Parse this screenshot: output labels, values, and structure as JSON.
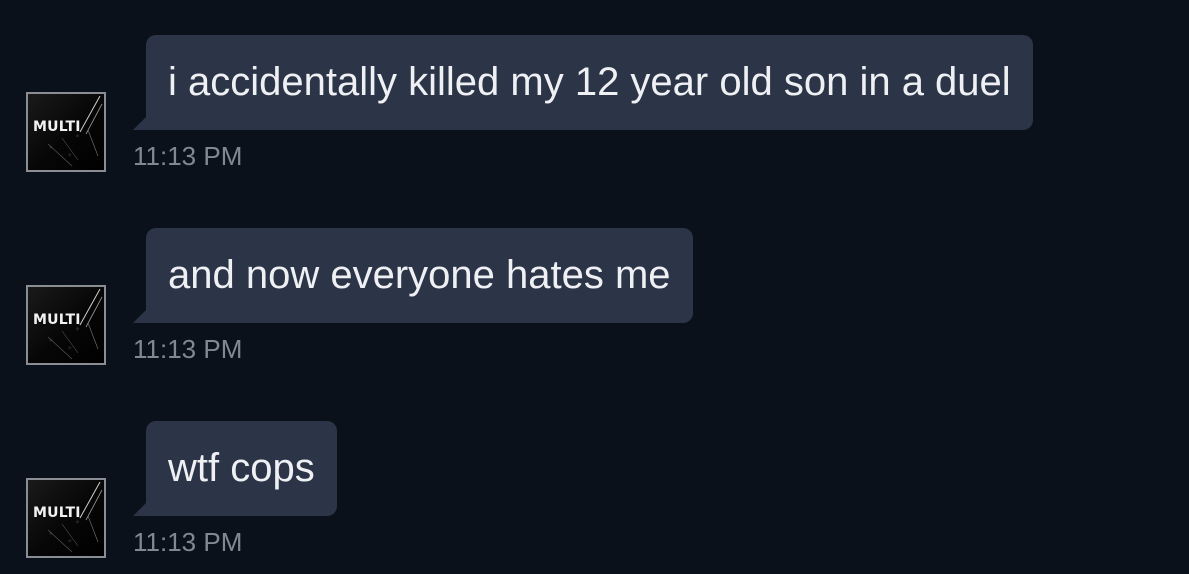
{
  "conversation": {
    "messages": [
      {
        "avatar_text": "MULTI",
        "text": "i accidentally killed my 12 year old son in a duel",
        "time": "11:13 PM"
      },
      {
        "avatar_text": "MULTI",
        "text": "and now everyone hates me",
        "time": "11:13 PM"
      },
      {
        "avatar_text": "MULTI",
        "text": "wtf cops",
        "time": "11:13 PM"
      }
    ]
  },
  "colors": {
    "background": "#0b111a",
    "bubble": "#2c3447",
    "bubble_text": "#eef0f3",
    "timestamp": "#808892",
    "avatar_border": "#8a8e94"
  },
  "icons": {
    "avatar": "multi-logo-avatar"
  }
}
